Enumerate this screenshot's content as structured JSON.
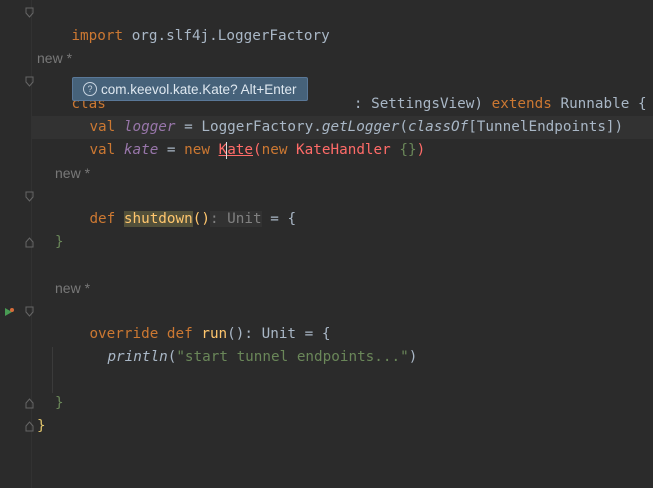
{
  "editor": {
    "line_import": {
      "kw": "import",
      "rest": " org.slf4j.LoggerFactory"
    },
    "lens_1": "new *",
    "line_class": {
      "head": "clas",
      "tail_type": ": SettingsView",
      "paren": ")",
      "extends_kw": " extends ",
      "extends_type": "Runnable",
      "brace": " {"
    },
    "line_logger": {
      "kw": "val",
      "name": " logger",
      "eq": " = LoggerFactory.",
      "method": "getLogger",
      "open": "(",
      "classof": "classOf",
      "bracket": "[TunnelEndpoints])"
    },
    "line_kate": {
      "kw": "val",
      "name": "kate",
      "eq": " = ",
      "new1": "new",
      "k1": "K",
      "ate": "ate",
      "open": "(",
      "new2": "new",
      "handler": " KateHandler ",
      "braces": "{}",
      "close": ")"
    },
    "lens_2": "new *",
    "line_def_shutdown": {
      "kw": "def",
      "name": "shutdown",
      "parens": "()",
      "ret": ": Unit",
      "eq": " = {"
    },
    "line_close_1": "}",
    "lens_3": "new *",
    "line_override": {
      "kw": "override def",
      "name": " run",
      "sig": "(): Unit = {"
    },
    "line_println": {
      "fn": "println",
      "open": "(",
      "str": "\"start tunnel endpoints...\"",
      "close": ")"
    },
    "line_close_2": "}",
    "line_close_3": "}"
  },
  "tooltip": {
    "icon": "?",
    "text": "com.keevol.kate.Kate? Alt+Enter"
  }
}
